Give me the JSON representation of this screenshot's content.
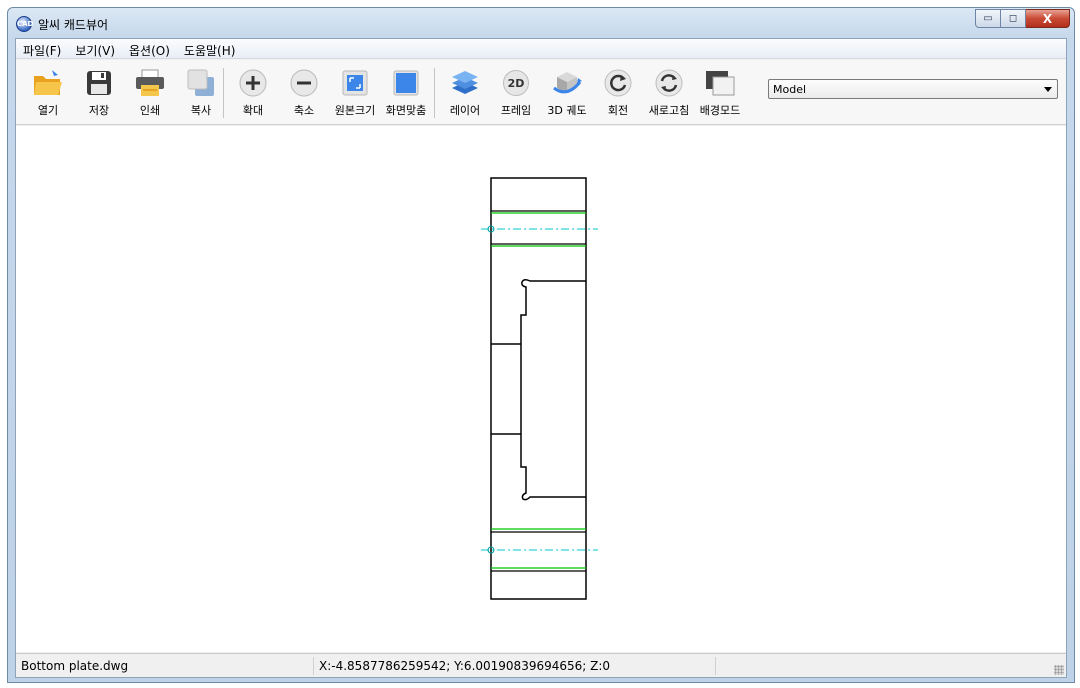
{
  "window": {
    "title": "알씨 캐드뷰어",
    "app_icon_text": "CAD",
    "minimize_glyph": "▭",
    "maximize_glyph": "◻",
    "close_glyph": "X"
  },
  "menu": [
    "파일(F)",
    "보기(V)",
    "옵션(O)",
    "도움말(H)"
  ],
  "toolbar": {
    "buttons": [
      {
        "label": "열기",
        "icon": "folder-open-icon"
      },
      {
        "label": "저장",
        "icon": "floppy-save-icon"
      },
      {
        "label": "인쇄",
        "icon": "printer-icon"
      },
      {
        "label": "복사",
        "icon": "copy-icon"
      },
      {
        "label": "확대",
        "icon": "zoom-in-icon"
      },
      {
        "label": "축소",
        "icon": "zoom-out-icon"
      },
      {
        "label": "원본크기",
        "icon": "original-size-icon"
      },
      {
        "label": "화면맞춤",
        "icon": "fit-screen-icon"
      },
      {
        "label": "레이어",
        "icon": "layers-icon"
      },
      {
        "label": "프레임",
        "icon": "2d-frame-icon",
        "icon_text": "2D"
      },
      {
        "label": "3D 궤도",
        "icon": "3d-orbit-icon"
      },
      {
        "label": "회전",
        "icon": "rotate-icon"
      },
      {
        "label": "새로고침",
        "icon": "refresh-icon"
      },
      {
        "label": "배경모드",
        "icon": "background-mode-icon"
      }
    ],
    "layout_select": {
      "value": "Model"
    }
  },
  "status": {
    "file": "Bottom plate.dwg",
    "coords": "X:-4.8587786259542; Y:6.00190839694656; Z:0"
  },
  "colors": {
    "drawing_line": "#000000",
    "green_line": "#00c800",
    "centerline": "#00c8c8",
    "accent_blue": "#3b86e8"
  }
}
